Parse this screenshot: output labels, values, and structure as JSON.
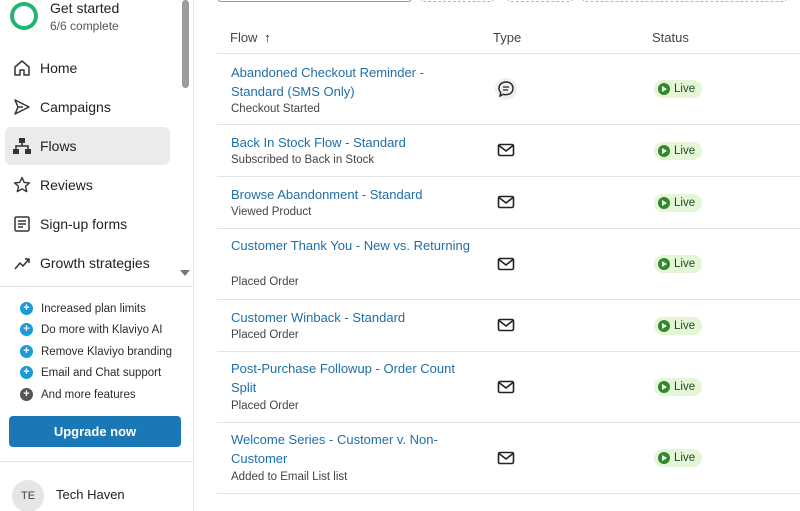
{
  "getting_started": {
    "title": "Get started",
    "progress": "6/6 complete"
  },
  "sidebar": {
    "items": [
      {
        "label": "Home",
        "icon": "home-icon"
      },
      {
        "label": "Campaigns",
        "icon": "send-icon"
      },
      {
        "label": "Flows",
        "icon": "flows-icon",
        "active": true
      },
      {
        "label": "Reviews",
        "icon": "star-icon"
      },
      {
        "label": "Sign-up forms",
        "icon": "form-icon"
      },
      {
        "label": "Growth strategies",
        "icon": "trend-icon"
      }
    ],
    "upsell": [
      "Increased plan limits",
      "Do more with Klaviyo AI",
      "Remove Klaviyo branding",
      "Email and Chat support",
      "And more features"
    ],
    "upgrade_label": "Upgrade now",
    "account": {
      "initials": "TE",
      "name": "Tech Haven"
    }
  },
  "table": {
    "headers": {
      "flow": "Flow",
      "sort": "↑",
      "type": "Type",
      "status": "Status"
    },
    "rows": [
      {
        "name": "Abandoned Checkout Reminder - Standard (SMS Only)",
        "trigger": "Checkout Started",
        "type": "sms-icon",
        "status": "Live"
      },
      {
        "name": "Back In Stock Flow - Standard",
        "trigger": "Subscribed to Back in Stock",
        "type": "email-icon",
        "status": "Live"
      },
      {
        "name": "Browse Abandonment - Standard",
        "trigger": "Viewed Product",
        "type": "email-icon",
        "status": "Live"
      },
      {
        "name": "Customer Thank You - New vs. Returning",
        "trigger": "Placed Order",
        "type": "email-icon",
        "status": "Live"
      },
      {
        "name": "Customer Winback - Standard",
        "trigger": "Placed Order",
        "type": "email-icon",
        "status": "Live"
      },
      {
        "name": "Post-Purchase Followup - Order Count Split",
        "trigger": "Placed Order",
        "type": "email-icon",
        "status": "Live"
      },
      {
        "name": "Welcome Series - Customer v. Non-Customer",
        "trigger": "Added to Email List list",
        "type": "email-icon",
        "status": "Live"
      }
    ]
  },
  "colors": {
    "accent": "#1978b5",
    "link": "#1e6fa8",
    "live_bg": "#e4f5d8",
    "live_dot": "#2f8a2a",
    "ring": "#22b573"
  }
}
